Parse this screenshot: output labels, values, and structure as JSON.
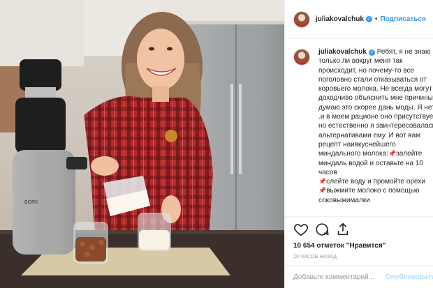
{
  "post": {
    "username": "juliakovalchuk",
    "follow_label": "Подписаться",
    "caption_lines": [
      "Ребят, я не знаю",
      "только ли вокруг меня так",
      "происходит, но почему-то все",
      "поголовно стали отказываться от",
      "коровьего молока. Не всегда могут",
      "доходчиво объяснить мне причины,",
      "думаю это скорее дань моды. Я нет",
      ".и в моем рационе оно присутствует",
      "но естественно я заинтересовалась",
      "альтернативами ему. И вот вам",
      "рецепт наивкуснейшего",
      "миндального молока:"
    ],
    "steps": [
      {
        "a": "залейте",
        "b": "миндаль водой и оставьте на 10",
        "c": "часов"
      },
      {
        "a": "слейте воду и промойте орехи"
      },
      {
        "a": "выжмите молоко с помощью",
        "b": "соковыжималки"
      }
    ],
    "likes_text": "10 654 отметок \"Нравится\"",
    "time_text": "20 ЧАСОВ НАЗАД",
    "comment_placeholder": "Добавьте комментарий...",
    "publish_label": "Опубликовать"
  },
  "photo": {
    "juicer_brand": "BORK"
  },
  "icons": [
    "heart-icon",
    "comment-icon",
    "share-icon",
    "verified-badge-icon",
    "pin-icon"
  ],
  "colors": {
    "accent": "#3897f0",
    "pin": "#d0021b",
    "shirt": "#b8342f"
  }
}
